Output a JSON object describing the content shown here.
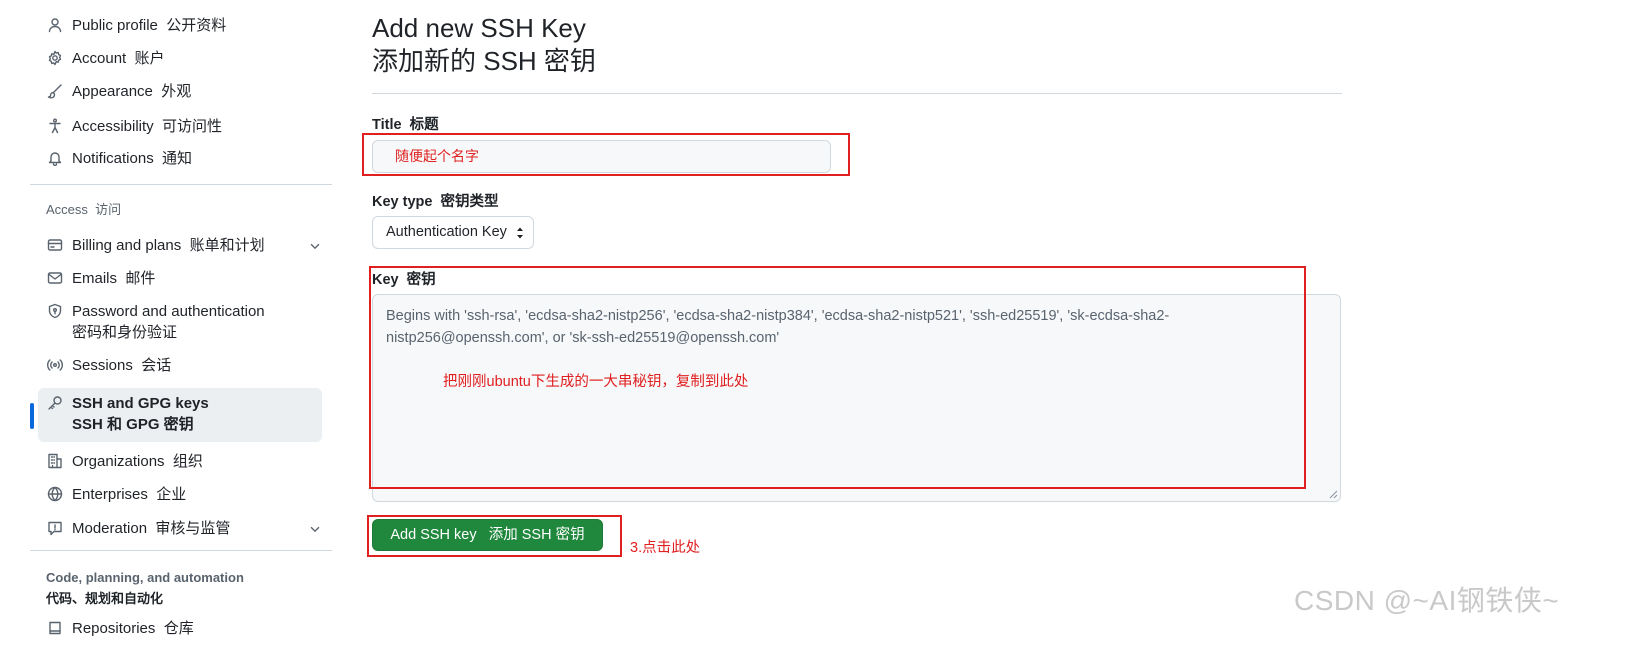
{
  "sidebar": {
    "items_top": [
      {
        "label": "Public profile",
        "cn": "公开资料",
        "icon": "person-icon"
      },
      {
        "label": "Account",
        "cn": "账户",
        "icon": "gear-icon"
      },
      {
        "label": "Appearance",
        "cn": "外观",
        "icon": "paintbrush-icon"
      },
      {
        "label": "Accessibility",
        "cn": "可访问性",
        "icon": "accessibility-icon"
      },
      {
        "label": "Notifications",
        "cn": "通知",
        "icon": "bell-icon"
      }
    ],
    "access_heading": "Access",
    "access_heading_cn": "访问",
    "items_access": [
      {
        "label": "Billing and plans",
        "cn": "账单和计划",
        "icon": "credit-card-icon"
      },
      {
        "label": "Emails",
        "cn": "邮件",
        "icon": "mail-icon"
      },
      {
        "label": "Password and authentication",
        "cn": "密码和身份验证",
        "icon": "shield-lock-icon"
      },
      {
        "label": "Sessions",
        "cn": "会话",
        "icon": "broadcast-icon"
      },
      {
        "label": "SSH and GPG keys",
        "cn": "SSH 和 GPG 密钥",
        "icon": "key-icon"
      },
      {
        "label": "Organizations",
        "cn": "组织",
        "icon": "organization-icon"
      },
      {
        "label": "Enterprises",
        "cn": "企业",
        "icon": "globe-icon"
      },
      {
        "label": "Moderation",
        "cn": "审核与监管",
        "icon": "report-icon"
      }
    ],
    "code_heading": "Code, planning, and automation",
    "code_heading_cn": "代码、规划和自动化",
    "repositories": {
      "label": "Repositories",
      "cn": "仓库",
      "icon": "repo-icon"
    }
  },
  "main": {
    "title": "Add new SSH Key",
    "title_cn": "添加新的 SSH 密钥",
    "title_field": {
      "label": "Title",
      "label_cn": "标题",
      "value": "随便起个名字"
    },
    "key_type": {
      "label": "Key type",
      "label_cn": "密钥类型",
      "selected": "Authentication Key"
    },
    "key_field": {
      "label": "Key",
      "label_cn": "密钥",
      "placeholder": "Begins with 'ssh-rsa', 'ecdsa-sha2-nistp256', 'ecdsa-sha2-nistp384', 'ecdsa-sha2-nistp521', 'ssh-ed25519', 'sk-ecdsa-sha2-nistp256@openssh.com', or 'sk-ssh-ed25519@openssh.com'",
      "annotation": "把刚刚ubuntu下生成的一大串秘钥，复制到此处"
    },
    "submit": {
      "label": "Add SSH key",
      "label_cn": "添加 SSH 密钥"
    },
    "submit_annotation": "3.点击此处"
  },
  "watermark": "CSDN @~AI钢铁侠~",
  "colors": {
    "annotation": "#e02020",
    "primary_button": "#1f883d",
    "selected_indicator": "#0969da"
  }
}
